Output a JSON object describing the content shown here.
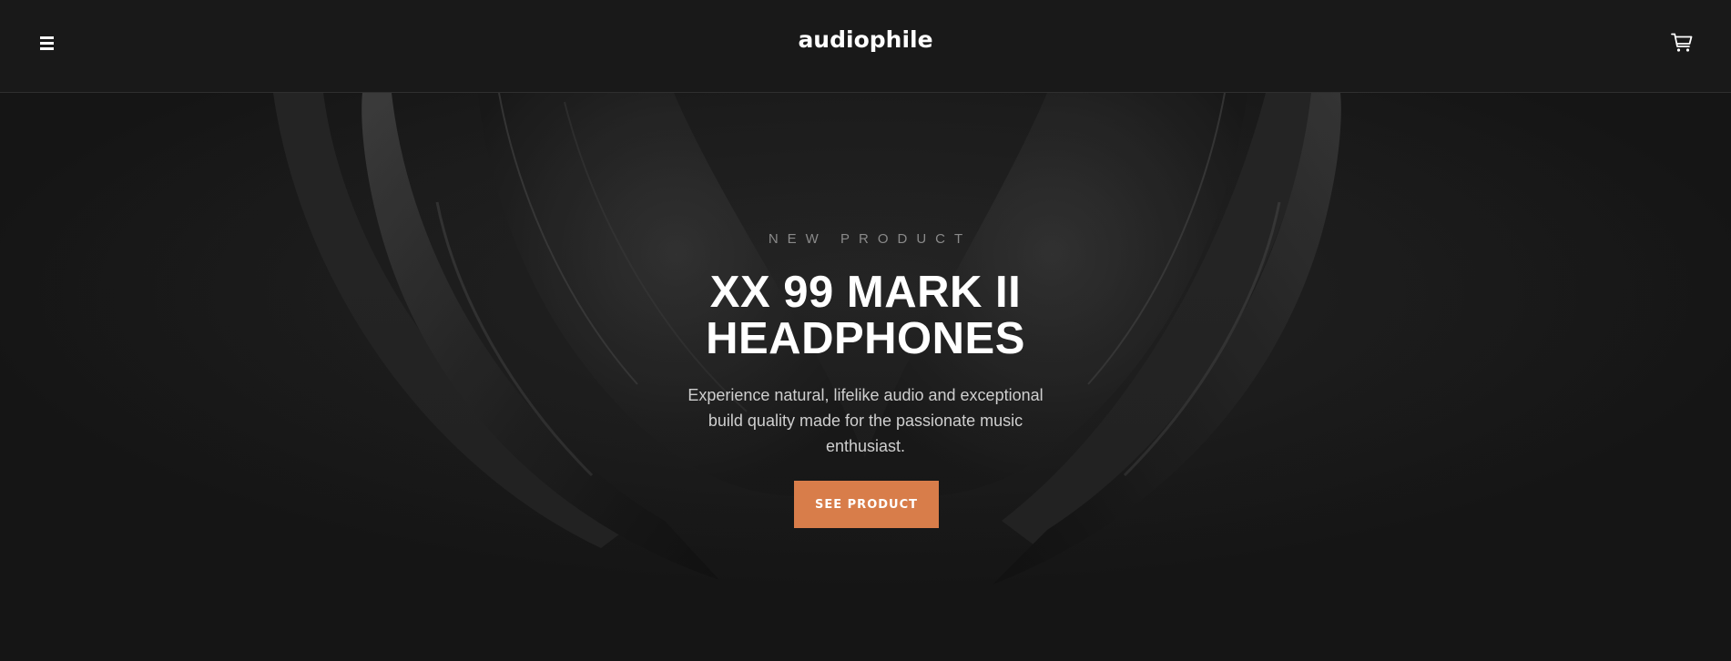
{
  "header": {
    "logo": "audiophile",
    "menu_icon": "hamburger-menu-icon",
    "cart_icon": "shopping-cart-icon"
  },
  "hero": {
    "overline": "NEW PRODUCT",
    "title_line1": "XX 99 MARK II",
    "title_line2": "HEADPHONES",
    "description": "Experience natural, lifelike audio and exceptional build quality made for the passionate music enthusiast.",
    "cta_label": "SEE PRODUCT",
    "image": "headphones-photo"
  },
  "colors": {
    "background": "#191919",
    "accent": "#d87d4a",
    "text": "#ffffff",
    "muted_text": "#8a8a8a"
  }
}
